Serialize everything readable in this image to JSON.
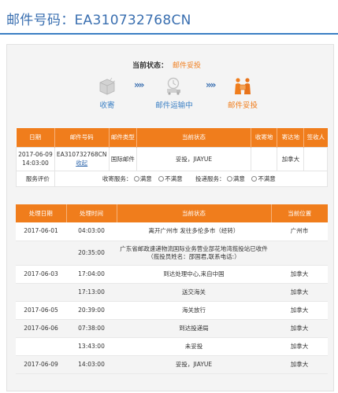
{
  "header": {
    "title": "邮件号码：EA310732768CN"
  },
  "status": {
    "label": "当前状态：",
    "value": "邮件妥投"
  },
  "steps": [
    {
      "label": "收寄",
      "icon": "box-icon"
    },
    {
      "label": "邮件运输中",
      "icon": "delivery-truck-icon"
    },
    {
      "label": "邮件妥投",
      "icon": "courier-handover-icon"
    }
  ],
  "chevrons": "»»",
  "summary": {
    "headers": [
      "日期",
      "邮件号码",
      "邮件类型",
      "当前状态",
      "收寄地",
      "寄达地",
      "签收人"
    ],
    "row": {
      "date": "2017-06-09 14:03:00",
      "number": "EA310732768CN",
      "subscribe": "收起",
      "type": "国际邮件",
      "status": "妥投，JIAYUE",
      "origin": "",
      "destination": "加拿大",
      "signer": ""
    },
    "eval": {
      "label": "服务评价",
      "collect_label": "收寄服务：",
      "deliver_label": "投递服务：",
      "opt_good": "满意",
      "opt_bad": "不满意"
    }
  },
  "tracking": {
    "headers": [
      "处理日期",
      "处理时间",
      "当前状态",
      "当前位置"
    ],
    "rows": [
      {
        "date": "2017-06-01",
        "time": "04:03:00",
        "status": "离开广州市 发往多伦多市（经转）",
        "location": "广州市"
      },
      {
        "date": "",
        "time": "20:35:00",
        "status": "广东省邮政速递物流国际业务营业部花地湾揽投站已收件（揽投员姓名：邵国君,联系电话:）",
        "location": ""
      },
      {
        "date": "2017-06-03",
        "time": "17:04:00",
        "status": "到达处理中心,来自中国",
        "location": "加拿大"
      },
      {
        "date": "",
        "time": "17:13:00",
        "status": "送交海关",
        "location": "加拿大"
      },
      {
        "date": "2017-06-05",
        "time": "20:39:00",
        "status": "海关放行",
        "location": "加拿大"
      },
      {
        "date": "2017-06-06",
        "time": "07:38:00",
        "status": "到达投递局",
        "location": "加拿大"
      },
      {
        "date": "",
        "time": "13:43:00",
        "status": "未妥投",
        "location": "加拿大"
      },
      {
        "date": "2017-06-09",
        "time": "14:03:00",
        "status": "妥投，JIAYUE",
        "location": "加拿大"
      }
    ]
  },
  "colors": {
    "accent": "#f07d1c",
    "brand_blue": "#3a6fb0"
  }
}
